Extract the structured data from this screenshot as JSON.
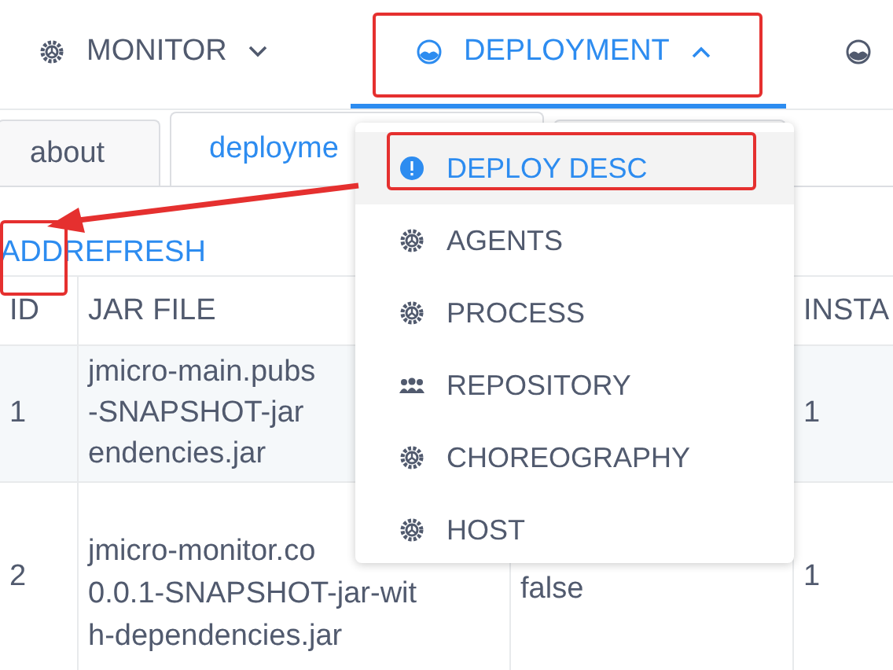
{
  "nav": [
    {
      "label": "MONITOR",
      "expanded": false,
      "selected": false
    },
    {
      "label": "DEPLOYMENT",
      "expanded": true,
      "selected": true
    },
    {
      "selected": false
    }
  ],
  "tabs": [
    {
      "label": "about",
      "selected": false
    },
    {
      "label": "deployme",
      "selected": true
    },
    {
      "selected": false
    }
  ],
  "toolbar": [
    "ADD",
    "REFRESH"
  ],
  "table": {
    "columns": [
      "ID",
      "JAR FILE",
      "",
      "INSTA"
    ],
    "rows": [
      {
        "cells": [
          [
            "1"
          ],
          [
            "jmicro-main.pubs",
            "-SNAPSHOT-jar",
            "endencies.jar"
          ],
          [],
          [
            "1"
          ]
        ]
      },
      {
        "cells": [
          [
            "2"
          ],
          [
            "jmicro-monitor.co",
            "0.0.1-SNAPSHOT-jar-wit",
            "h-dependencies.jar"
          ],
          [
            "false"
          ],
          [
            "1"
          ]
        ]
      }
    ]
  },
  "menu": [
    {
      "label": "DEPLOY DESC",
      "selected": true
    },
    {
      "label": "AGENTS",
      "selected": false
    },
    {
      "label": "PROCESS",
      "selected": false
    },
    {
      "label": "REPOSITORY",
      "selected": false
    },
    {
      "label": "CHOREOGRAPHY",
      "selected": false
    },
    {
      "label": "HOST",
      "selected": false
    }
  ]
}
